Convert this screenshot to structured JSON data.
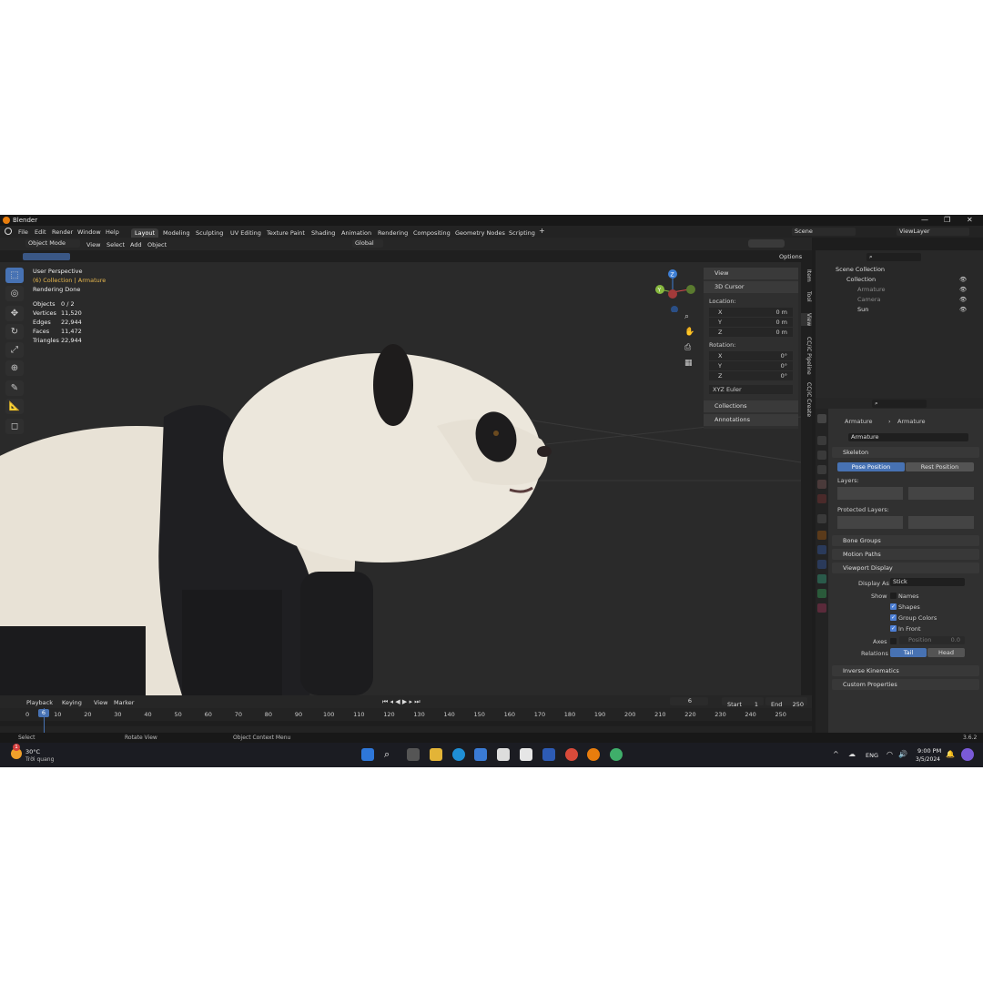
{
  "window": {
    "title": "Blender",
    "minimize": "—",
    "maximize": "❐",
    "close": "✕"
  },
  "menu": [
    "File",
    "Edit",
    "Render",
    "Window",
    "Help"
  ],
  "workspaces": [
    "Layout",
    "Modeling",
    "Sculpting",
    "UV Editing",
    "Texture Paint",
    "Shading",
    "Animation",
    "Rendering",
    "Compositing",
    "Geometry Nodes",
    "Scripting"
  ],
  "workspace_add": "+",
  "scene": {
    "label": "Scene",
    "viewlayer": "ViewLayer"
  },
  "header3d": {
    "mode": "Object Mode",
    "view": "View",
    "select": "Select",
    "add": "Add",
    "object": "Object",
    "orientation": "Global",
    "options": "Options"
  },
  "overlay": {
    "perspective": "User Perspective",
    "collection": "(6) Collection | Armature",
    "status": "Rendering Done",
    "stats": [
      {
        "label": "Objects",
        "value": "0 / 2"
      },
      {
        "label": "Vertices",
        "value": "11,520"
      },
      {
        "label": "Edges",
        "value": "22,944"
      },
      {
        "label": "Faces",
        "value": "11,472"
      },
      {
        "label": "Triangles",
        "value": "22,944"
      }
    ]
  },
  "gizmo": {
    "x": "X",
    "y": "Y",
    "z": "Z"
  },
  "npanel": {
    "view": "View",
    "cursor": "3D Cursor",
    "location": "Location:",
    "loc": [
      {
        "axis": "X",
        "value": "0 m"
      },
      {
        "axis": "Y",
        "value": "0 m"
      },
      {
        "axis": "Z",
        "value": "0 m"
      }
    ],
    "rotation": "Rotation:",
    "rot": [
      {
        "axis": "X",
        "value": "0°"
      },
      {
        "axis": "Y",
        "value": "0°"
      },
      {
        "axis": "Z",
        "value": "0°"
      }
    ],
    "euler": "XYZ Euler",
    "collections": "Collections",
    "annotations": "Annotations"
  },
  "side_tabs": [
    "Item",
    "Tool",
    "View",
    "CC/iC Pipeline",
    "CC/iC Create"
  ],
  "outliner": {
    "scene_collection": "Scene Collection",
    "collection": "Collection",
    "items": [
      "Armature",
      "Camera",
      "Sun"
    ]
  },
  "properties": {
    "breadcrumb_a": "Armature",
    "breadcrumb_b": "Armature",
    "data_name": "Armature",
    "skeleton": "Skeleton",
    "pose_position": "Pose Position",
    "rest_position": "Rest Position",
    "layers": "Layers:",
    "protected_layers": "Protected Layers:",
    "bone_groups": "Bone Groups",
    "motion_paths": "Motion Paths",
    "viewport_display": "Viewport Display",
    "display_as_label": "Display As",
    "display_as_value": "Stick",
    "show_label": "Show",
    "names": "Names",
    "shapes": "Shapes",
    "group_colors": "Group Colors",
    "in_front": "In Front",
    "axes_label": "Axes",
    "position_label": "Position",
    "position_value": "0.0",
    "relations_label": "Relations",
    "tail": "Tail",
    "head": "Head",
    "inverse_kinematics": "Inverse Kinematics",
    "custom_properties": "Custom Properties"
  },
  "timeline": {
    "playback": "Playback",
    "keying": "Keying",
    "view": "View",
    "marker": "Marker",
    "current_frame": "6",
    "start_label": "Start",
    "start": "1",
    "end_label": "End",
    "end": "250",
    "ticks": [
      "0",
      "10",
      "20",
      "30",
      "40",
      "50",
      "60",
      "70",
      "80",
      "90",
      "100",
      "110",
      "120",
      "130",
      "140",
      "150",
      "160",
      "170",
      "180",
      "190",
      "200",
      "210",
      "220",
      "230",
      "240",
      "250"
    ],
    "cursor_label": "6"
  },
  "status": {
    "select": "Select",
    "rotate": "Rotate View",
    "context": "Object Context Menu",
    "version": "3.6.2"
  },
  "taskbar": {
    "weather_temp": "30°C",
    "weather_desc": "Trời quang",
    "lang": "ENG",
    "time": "9:00 PM",
    "date": "3/5/2024",
    "badge": "1"
  },
  "colors": {
    "accent": "#4772b3",
    "selected_text": "#e8b84e",
    "axis_x": "#d44a4a",
    "axis_y": "#86b83e",
    "axis_z": "#3e7fd4"
  }
}
